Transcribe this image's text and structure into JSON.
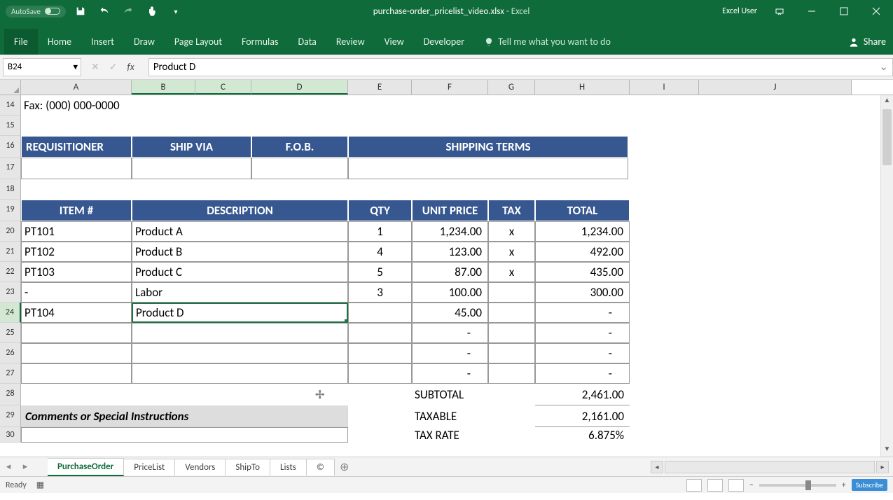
{
  "titlebar": {
    "autosave": "AutoSave",
    "filename": "purchase-order_pricelist_video.xlsx",
    "appname": "Excel",
    "username": "Excel User"
  },
  "ribbon": {
    "tabs": [
      "File",
      "Home",
      "Insert",
      "Draw",
      "Page Layout",
      "Formulas",
      "Data",
      "Review",
      "View",
      "Developer"
    ],
    "tellme": "Tell me what you want to do",
    "share": "Share"
  },
  "fbar": {
    "namebox": "B24",
    "formula": "Product D"
  },
  "columns": [
    "A",
    "B",
    "C",
    "D",
    "E",
    "F",
    "G",
    "H",
    "I",
    "J"
  ],
  "rows_shown": [
    "14",
    "15",
    "16",
    "17",
    "18",
    "19",
    "20",
    "21",
    "22",
    "23",
    "24",
    "25",
    "26",
    "27",
    "28",
    "29",
    "30"
  ],
  "sheet": {
    "fax": "Fax: (000) 000-0000",
    "hdr1": {
      "req": "REQUISITIONER",
      "shipvia": "SHIP VIA",
      "fob": "F.O.B.",
      "terms": "SHIPPING TERMS"
    },
    "hdr2": {
      "item": "ITEM #",
      "desc": "DESCRIPTION",
      "qty": "QTY",
      "unit": "UNIT PRICE",
      "tax": "TAX",
      "total": "TOTAL"
    },
    "items": [
      {
        "sku": "PT101",
        "desc": "Product A",
        "qty": "1",
        "unit": "1,234.00",
        "tax": "x",
        "total": "1,234.00"
      },
      {
        "sku": "PT102",
        "desc": "Product B",
        "qty": "4",
        "unit": "123.00",
        "tax": "x",
        "total": "492.00"
      },
      {
        "sku": "PT103",
        "desc": "Product C",
        "qty": "5",
        "unit": "87.00",
        "tax": "x",
        "total": "435.00"
      },
      {
        "sku": "-",
        "desc": "Labor",
        "qty": "3",
        "unit": "100.00",
        "tax": "",
        "total": "300.00"
      },
      {
        "sku": "PT104",
        "desc": "Product D",
        "qty": "",
        "unit": "45.00",
        "tax": "",
        "total": "-"
      }
    ],
    "blank_dash": "-",
    "summary": {
      "subtotal_l": "SUBTOTAL",
      "subtotal_v": "2,461.00",
      "taxable_l": "TAXABLE",
      "taxable_v": "2,161.00",
      "rate_l": "TAX RATE",
      "rate_v": "6.875%"
    },
    "comments": "Comments or Special Instructions"
  },
  "sheettabs": [
    "PurchaseOrder",
    "PriceList",
    "Vendors",
    "ShipTo",
    "Lists",
    "©"
  ],
  "status": {
    "ready": "Ready",
    "subscribe": "Subscribe"
  }
}
